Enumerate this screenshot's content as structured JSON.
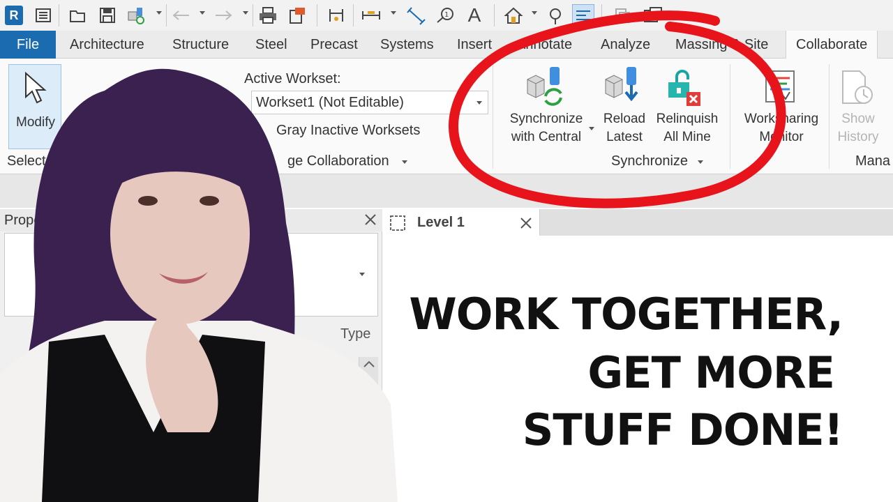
{
  "app": {
    "logo_letter": "R"
  },
  "quick_access": {
    "icons": [
      "open-icon",
      "save-icon",
      "sync-icon",
      "undo-icon",
      "redo-icon",
      "print-icon",
      "export-icon",
      "measure-icon",
      "dimension-icon",
      "tag-icon",
      "text-icon",
      "home-view-icon",
      "section-icon",
      "thin-lines-icon",
      "switch-windows-icon",
      "close-inactive-icon"
    ],
    "text_tool": "A"
  },
  "tabs": {
    "file": "File",
    "items": [
      "Architecture",
      "Structure",
      "Steel",
      "Precast",
      "Systems",
      "Insert",
      "Annotate",
      "Analyze",
      "Massing & Site",
      "Collaborate"
    ],
    "active": "Collaborate"
  },
  "ribbon": {
    "select": {
      "modify_label": "Modify",
      "panel_title": "Select"
    },
    "manage_collab": {
      "active_workset_label": "Active Workset:",
      "active_workset_value": "Workset1 (Not Editable)",
      "gray_inactive": "Gray Inactive Worksets",
      "panel_title": "ge Collaboration"
    },
    "synchronize": {
      "sync_central": [
        "Synchronize",
        "with Central"
      ],
      "reload_latest": [
        "Reload",
        "Latest"
      ],
      "relinquish": [
        "Relinquish",
        "All Mine"
      ],
      "panel_title": "Synchronize"
    },
    "worksharing_monitor": [
      "Worksharing",
      "Monitor"
    ],
    "manage_models": {
      "show_history": [
        "Show",
        "History"
      ],
      "panel_title": "Mana"
    }
  },
  "properties": {
    "title": "Proper",
    "type_label": "Type"
  },
  "view_tab": {
    "title": "Level 1"
  },
  "headline": {
    "line1": "WORK TOGETHER,",
    "line2": "GET MORE",
    "line3": "STUFF DONE!"
  },
  "colors": {
    "annotation_red": "#e8141b",
    "file_tab_blue": "#1a6bb0",
    "hair_purple": "#3a2150"
  }
}
